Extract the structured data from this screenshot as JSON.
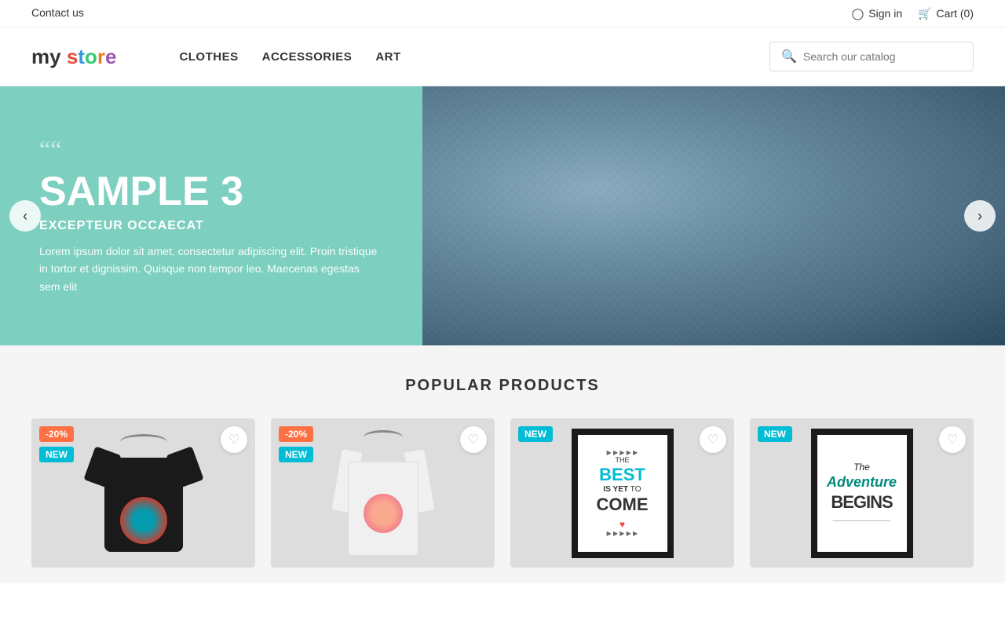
{
  "topbar": {
    "contact_label": "Contact us",
    "signin_label": "Sign in",
    "cart_label": "Cart (0)"
  },
  "header": {
    "logo": {
      "my": "my",
      "space": " ",
      "store": "store"
    },
    "nav": {
      "items": [
        {
          "label": "CLOTHES",
          "href": "#"
        },
        {
          "label": "ACCESSORIES",
          "href": "#"
        },
        {
          "label": "ART",
          "href": "#"
        }
      ]
    },
    "search": {
      "placeholder": "Search our catalog"
    }
  },
  "hero": {
    "quote_mark": "““",
    "title": "SAMPLE 3",
    "subtitle": "EXCEPTEUR OCCAECAT",
    "description": "Lorem ipsum dolor sit amet, consectetur adipiscing elit. Proin tristique in tortor et dignissim. Quisque non tempor leo. Maecenas egestas sem elit",
    "prev_label": "‹",
    "next_label": "›"
  },
  "popular": {
    "section_title": "POPULAR PRODUCTS",
    "products": [
      {
        "id": 1,
        "type": "tshirt-black",
        "badge_discount": "-20%",
        "badge_new": "NEW"
      },
      {
        "id": 2,
        "type": "longsleeve-white",
        "badge_discount": "-20%",
        "badge_new": "NEW"
      },
      {
        "id": 3,
        "type": "poster-best",
        "badge_new": "NEW"
      },
      {
        "id": 4,
        "type": "poster-adventure",
        "badge_new": "NEW"
      }
    ]
  }
}
